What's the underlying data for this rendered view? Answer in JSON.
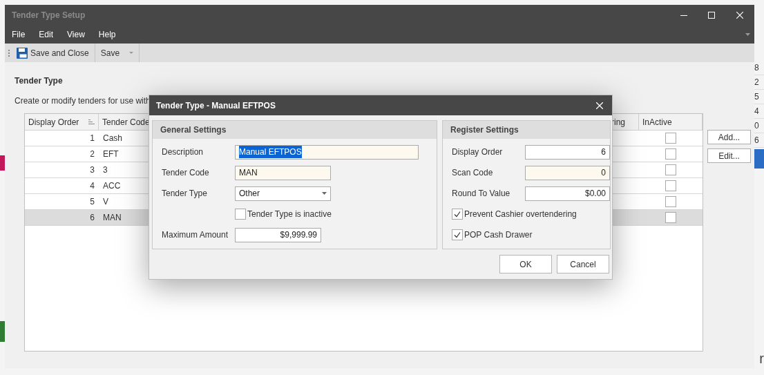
{
  "background_app": {
    "right_edge_values": [
      "8",
      "2",
      "5",
      "4",
      "0",
      "6"
    ],
    "bottom_right_text": "r"
  },
  "window": {
    "title": "Tender Type Setup"
  },
  "menu": [
    "File",
    "Edit",
    "View",
    "Help"
  ],
  "toolbar": {
    "save_and_close": "Save and Close",
    "save": "Save"
  },
  "section": {
    "title": "Tender Type",
    "description": "Create or modify tenders for use with"
  },
  "table": {
    "columns": [
      {
        "label": "Display Order",
        "sorted": true
      },
      {
        "label": "Tender Code"
      },
      {
        "label": "ring"
      },
      {
        "label": "InActive"
      }
    ],
    "rows": [
      {
        "order": "1",
        "code": "Cash",
        "inactive": false,
        "selected": false
      },
      {
        "order": "2",
        "code": "EFT",
        "inactive": false,
        "selected": false
      },
      {
        "order": "3",
        "code": "3",
        "inactive": false,
        "selected": false
      },
      {
        "order": "4",
        "code": "ACC",
        "inactive": false,
        "selected": false
      },
      {
        "order": "5",
        "code": "V",
        "inactive": false,
        "selected": false
      },
      {
        "order": "6",
        "code": "MAN",
        "inactive": false,
        "selected": true
      }
    ]
  },
  "side_buttons": [
    "Add...",
    "Edit..."
  ],
  "dialog": {
    "title": "Tender Type - Manual EFTPOS",
    "general": {
      "title": "General Settings",
      "fields": [
        {
          "kind": "text",
          "label": "Description",
          "value": "Manual EFTPOS",
          "required": true,
          "text_selected": true,
          "wide": true
        },
        {
          "kind": "text",
          "label": "Tender Code",
          "value": "MAN",
          "required": true,
          "text_selected": false,
          "wide": false
        },
        {
          "kind": "select",
          "label": "Tender Type",
          "value": "Other"
        },
        {
          "kind": "checkbox",
          "label": "Tender Type is inactive",
          "checked": false
        },
        {
          "kind": "amount",
          "label": "Maximum Amount",
          "value": "$9,999.99",
          "required": false
        }
      ]
    },
    "register": {
      "title": "Register Settings",
      "fields": [
        {
          "kind": "amount",
          "label": "Display Order",
          "value": "6",
          "required": false
        },
        {
          "kind": "amount",
          "label": "Scan Code",
          "value": "0",
          "required": true
        },
        {
          "kind": "amount",
          "label": "Round To Value",
          "value": "$0.00",
          "required": false
        },
        {
          "kind": "checkbox",
          "label": "Prevent Cashier overtendering",
          "checked": true
        },
        {
          "kind": "checkbox",
          "label": "POP Cash Drawer",
          "checked": true
        }
      ]
    },
    "buttons": [
      "OK",
      "Cancel"
    ]
  }
}
